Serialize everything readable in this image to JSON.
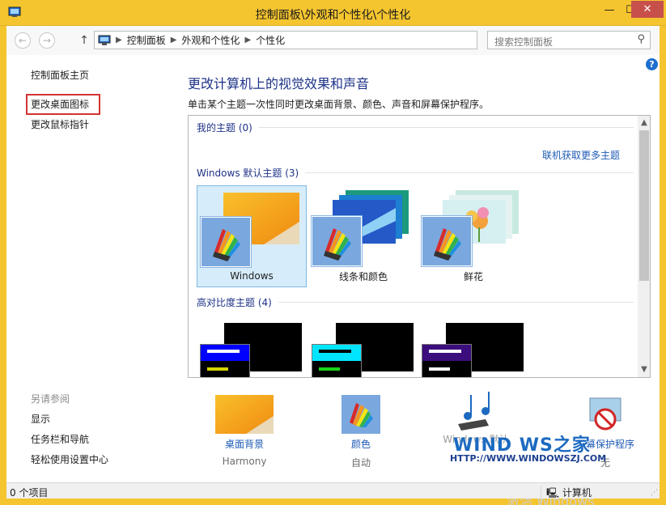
{
  "window": {
    "title": "控制面板\\外观和个性化\\个性化",
    "minimize": "—",
    "maximize": "☐",
    "close": "✕"
  },
  "nav": {
    "back": "←",
    "forward": "→",
    "up": "↑",
    "breadcrumbs": [
      "控制面板",
      "外观和个性化",
      "个性化"
    ],
    "dropdown": "⌵",
    "refresh": "↻",
    "search_placeholder": "搜索控制面板",
    "search_icon": "⚲"
  },
  "help": "?",
  "sidebar": {
    "home": "控制面板主页",
    "items": [
      "更改桌面图标",
      "更改鼠标指针"
    ],
    "see_also_label": "另请参阅",
    "see_also": [
      "显示",
      "任务栏和导航",
      "轻松使用设置中心"
    ]
  },
  "main": {
    "title": "更改计算机上的视觉效果和声音",
    "description": "单击某个主题一次性同时更改桌面背景、颜色、声音和屏幕保护程序。",
    "groups": {
      "my_themes": "我的主题 (0)",
      "get_more": "联机获取更多主题",
      "default_themes": "Windows 默认主题 (3)",
      "high_contrast": "高对比度主题 (4)"
    },
    "themes": [
      {
        "label": "Windows",
        "selected": true
      },
      {
        "label": "线条和颜色",
        "selected": false
      },
      {
        "label": "鲜花",
        "selected": false
      }
    ],
    "scroll_up": "▲",
    "scroll_down": "▼"
  },
  "bottom": {
    "items": [
      {
        "link": "桌面背景",
        "sub": "Harmony"
      },
      {
        "link": "颜色",
        "sub": "自动"
      },
      {
        "link": "Windows 默认",
        "sub": ""
      },
      {
        "link": "屏幕保护程序",
        "sub": "无"
      }
    ]
  },
  "status": {
    "left": "0 个项目",
    "right": "计算机"
  },
  "watermark": {
    "brand": "WIND WS之家",
    "url": "HTTP://WWW.WINDOWSZJ.COM",
    "activate": "激活 Windows"
  },
  "colors": {
    "titlebar": "#f5c52f",
    "link": "#1e5bb5",
    "heading": "#1e3287",
    "highlight": "#d23333",
    "selection": "#d6ecfa"
  }
}
